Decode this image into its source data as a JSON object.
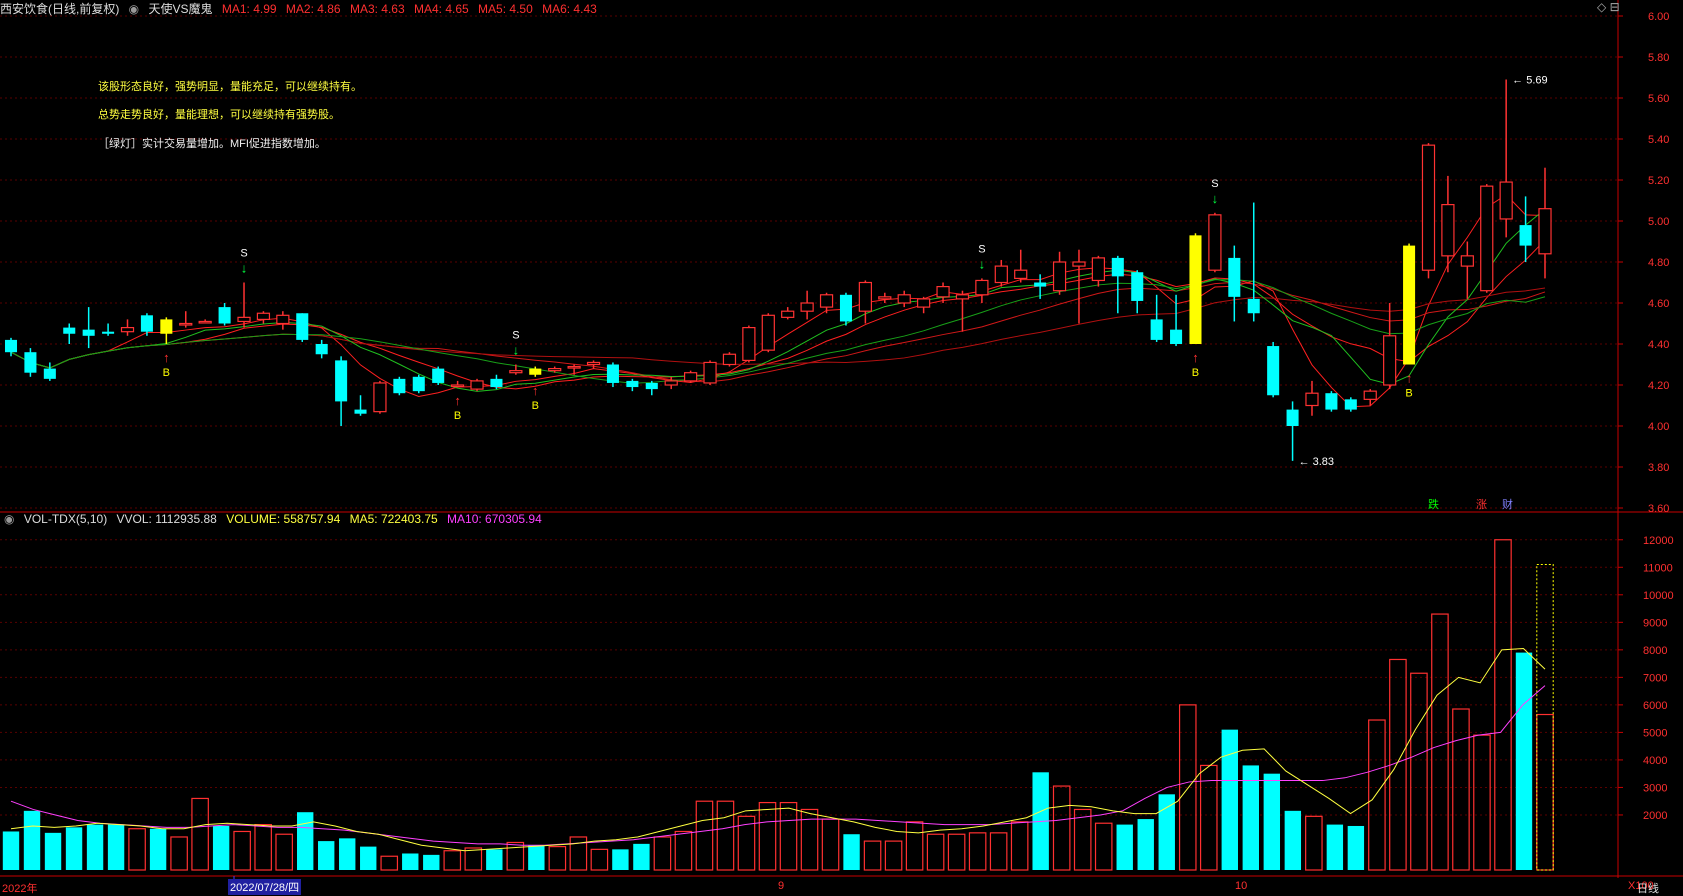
{
  "header": {
    "stock_title": "西安饮食(日线,前复权)",
    "indicator": "天使VS魔鬼",
    "ma": [
      "MA1: 4.99",
      "MA2: 4.86",
      "MA3: 4.63",
      "MA4: 4.65",
      "MA5: 4.50",
      "MA6: 4.43"
    ]
  },
  "notes": [
    "该股形态良好，强势明显，量能充足，可以继续持有。",
    "总势走势良好，量能理想，可以继续持有强势股。",
    "［绿灯］实计交易量增加。MFI促进指数增加。"
  ],
  "price_axis": [
    "6.00",
    "5.80",
    "5.60",
    "5.40",
    "5.20",
    "5.00",
    "4.80",
    "4.60",
    "4.40",
    "4.20",
    "4.00",
    "3.80",
    "3.60"
  ],
  "price_high_label": "5.69",
  "price_low_label": "3.83",
  "right_tags": [
    "跌",
    "涨",
    "财"
  ],
  "volume_header": {
    "name": "VOL-TDX(5,10)",
    "vvol": "VVOL: 1112935.88",
    "volume": "VOLUME: 558757.94",
    "ma5": "MA5: 722403.75",
    "ma10": "MA10: 670305.94"
  },
  "volume_axis": [
    "12000",
    "11000",
    "10000",
    "9000",
    "8000",
    "7000",
    "6000",
    "5000",
    "4000",
    "3000",
    "2000"
  ],
  "volume_unit": "X100",
  "date_axis": {
    "year": "2022年",
    "cursor": "2022/07/28/四",
    "m9": "9",
    "m10": "10",
    "period": "日线"
  },
  "signals": {
    "buy": "B",
    "sell": "S"
  },
  "colors": {
    "up": "#ff3232",
    "down": "#00ffff",
    "yellow": "#ffff00",
    "grid": "#5a0000",
    "axis": "#c80000"
  },
  "chart_data": {
    "type": "candlestick",
    "candles": [
      [
        4.42,
        4.36,
        4.43,
        4.34
      ],
      [
        4.36,
        4.26,
        4.38,
        4.24
      ],
      [
        4.28,
        4.23,
        4.31,
        4.22
      ],
      [
        4.48,
        4.45,
        4.5,
        4.4
      ],
      [
        4.47,
        4.44,
        4.58,
        4.38
      ],
      [
        4.46,
        4.45,
        4.5,
        4.44
      ],
      [
        4.46,
        4.48,
        4.52,
        4.44
      ],
      [
        4.54,
        4.46,
        4.55,
        4.44
      ],
      [
        4.52,
        4.45,
        4.53,
        4.4
      ],
      [
        4.5,
        4.5,
        4.56,
        4.48
      ],
      [
        4.51,
        4.51,
        4.52,
        4.5
      ],
      [
        4.58,
        4.5,
        4.6,
        4.49
      ],
      [
        4.51,
        4.53,
        4.7,
        4.48
      ],
      [
        4.52,
        4.55,
        4.56,
        4.5
      ],
      [
        4.5,
        4.54,
        4.56,
        4.47
      ],
      [
        4.55,
        4.42,
        4.55,
        4.41
      ],
      [
        4.4,
        4.35,
        4.42,
        4.33
      ],
      [
        4.32,
        4.12,
        4.34,
        4.0
      ],
      [
        4.08,
        4.06,
        4.15,
        4.05
      ],
      [
        4.07,
        4.21,
        4.22,
        4.06
      ],
      [
        4.23,
        4.16,
        4.24,
        4.15
      ],
      [
        4.24,
        4.17,
        4.25,
        4.16
      ],
      [
        4.28,
        4.21,
        4.29,
        4.2
      ],
      [
        4.2,
        4.2,
        4.22,
        4.19
      ],
      [
        4.18,
        4.22,
        4.23,
        4.17
      ],
      [
        4.23,
        4.19,
        4.25,
        4.18
      ],
      [
        4.26,
        4.27,
        4.3,
        4.25
      ],
      [
        4.28,
        4.25,
        4.29,
        4.24
      ],
      [
        4.27,
        4.28,
        4.29,
        4.26
      ],
      [
        4.29,
        4.29,
        4.3,
        4.25
      ],
      [
        4.3,
        4.31,
        4.32,
        4.28
      ],
      [
        4.3,
        4.21,
        4.31,
        4.19
      ],
      [
        4.22,
        4.19,
        4.23,
        4.17
      ],
      [
        4.21,
        4.18,
        4.22,
        4.15
      ],
      [
        4.2,
        4.22,
        4.24,
        4.18
      ],
      [
        4.22,
        4.26,
        4.27,
        4.21
      ],
      [
        4.21,
        4.31,
        4.32,
        4.2
      ],
      [
        4.3,
        4.35,
        4.36,
        4.29
      ],
      [
        4.32,
        4.48,
        4.49,
        4.31
      ],
      [
        4.37,
        4.54,
        4.55,
        4.36
      ],
      [
        4.53,
        4.56,
        4.58,
        4.52
      ],
      [
        4.56,
        4.6,
        4.66,
        4.52
      ],
      [
        4.58,
        4.64,
        4.65,
        4.55
      ],
      [
        4.64,
        4.51,
        4.65,
        4.49
      ],
      [
        4.56,
        4.7,
        4.71,
        4.5
      ],
      [
        4.62,
        4.63,
        4.65,
        4.6
      ],
      [
        4.6,
        4.64,
        4.66,
        4.58
      ],
      [
        4.58,
        4.62,
        4.63,
        4.55
      ],
      [
        4.63,
        4.68,
        4.7,
        4.6
      ],
      [
        4.62,
        4.64,
        4.66,
        4.46
      ],
      [
        4.64,
        4.71,
        4.72,
        4.6
      ],
      [
        4.7,
        4.78,
        4.81,
        4.68
      ],
      [
        4.72,
        4.76,
        4.86,
        4.7
      ],
      [
        4.7,
        4.68,
        4.74,
        4.62
      ],
      [
        4.66,
        4.8,
        4.85,
        4.64
      ],
      [
        4.78,
        4.8,
        4.86,
        4.5
      ],
      [
        4.71,
        4.82,
        4.83,
        4.68
      ],
      [
        4.82,
        4.73,
        4.83,
        4.55
      ],
      [
        4.75,
        4.61,
        4.76,
        4.55
      ],
      [
        4.52,
        4.42,
        4.64,
        4.41
      ],
      [
        4.47,
        4.4,
        4.64,
        4.39
      ],
      [
        4.4,
        4.93,
        4.94,
        4.4
      ],
      [
        4.76,
        5.03,
        5.04,
        4.75
      ],
      [
        4.82,
        4.63,
        4.88,
        4.51
      ],
      [
        4.62,
        4.55,
        5.09,
        4.51
      ],
      [
        4.39,
        4.15,
        4.41,
        4.14
      ],
      [
        4.08,
        4.0,
        4.12,
        3.83
      ],
      [
        4.1,
        4.16,
        4.22,
        4.05
      ],
      [
        4.16,
        4.08,
        4.17,
        4.07
      ],
      [
        4.13,
        4.08,
        4.14,
        4.07
      ],
      [
        4.13,
        4.17,
        4.18,
        4.1
      ],
      [
        4.2,
        4.44,
        4.6,
        4.18
      ],
      [
        4.3,
        4.88,
        4.89,
        4.3
      ],
      [
        4.76,
        5.37,
        5.38,
        4.72
      ],
      [
        4.83,
        5.08,
        5.22,
        4.75
      ],
      [
        4.78,
        4.83,
        4.9,
        4.62
      ],
      [
        4.66,
        5.17,
        5.18,
        4.65
      ],
      [
        5.01,
        5.19,
        5.69,
        4.92
      ],
      [
        4.98,
        4.88,
        5.12,
        4.8
      ],
      [
        4.84,
        5.06,
        5.26,
        4.72
      ]
    ],
    "candle_style": "up/down by open-close; yellow marked days",
    "yellow_days": [
      8,
      27,
      61,
      72
    ],
    "buy_days": [
      8,
      23,
      27,
      61,
      72
    ],
    "sell_days": [
      12,
      26,
      50,
      62
    ],
    "volumes": [
      1400,
      2150,
      1350,
      1550,
      1650,
      1650,
      1500,
      1500,
      1200,
      2600,
      1600,
      1400,
      1650,
      1300,
      2100,
      1050,
      1150,
      850,
      500,
      600,
      550,
      700,
      800,
      750,
      1000,
      900,
      850,
      1200,
      750,
      750,
      950,
      1200,
      1400,
      2500,
      2500,
      1950,
      2450,
      2450,
      2200,
      1850,
      1300,
      1050,
      1050,
      1750,
      1300,
      1300,
      1350,
      1350,
      1750,
      3550,
      3050,
      2200,
      1700,
      1650,
      1850,
      2750,
      6000,
      3800,
      5100,
      3800,
      3500,
      2150,
      1950,
      1650,
      1600,
      5450,
      7650,
      7150,
      9300,
      5850,
      4900,
      12000,
      7900,
      5650
    ],
    "ma5": [
      1500,
      1600,
      1550,
      1600,
      1700,
      1650,
      1600,
      1500,
      1500,
      1650,
      1700,
      1650,
      1600,
      1600,
      1750,
      1600,
      1400,
      1300,
      1100,
      900,
      800,
      700,
      750,
      800,
      850,
      900,
      950,
      1050,
      1100,
      1200,
      1400,
      1600,
      1800,
      1900,
      2150,
      2200,
      2250,
      2050,
      1900,
      1750,
      1550,
      1400,
      1350,
      1450,
      1500,
      1600,
      1750,
      1900,
      2250,
      2350,
      2300,
      2150,
      2050,
      2050,
      2500,
      3500,
      4100,
      4350,
      4400,
      3600,
      3100,
      2600,
      2050,
      2550,
      3650,
      5100,
      6350,
      7000,
      6800,
      8000,
      8050,
      7300
    ],
    "ma10": [
      2500,
      2200,
      2000,
      1800,
      1700,
      1650,
      1600,
      1550,
      1550,
      1600,
      1650,
      1600,
      1550,
      1550,
      1500,
      1450,
      1350,
      1250,
      1150,
      1050,
      1000,
      950,
      950,
      900,
      900,
      950,
      1000,
      1050,
      1100,
      1200,
      1300,
      1400,
      1500,
      1650,
      1750,
      1800,
      1850,
      1850,
      1850,
      1800,
      1750,
      1700,
      1650,
      1650,
      1650,
      1700,
      1750,
      1800,
      1900,
      2000,
      2150,
      2600,
      3000,
      3200,
      3250,
      3250,
      3250,
      3250,
      3250,
      3250,
      3350,
      3550,
      3800,
      4100,
      4450,
      4700,
      4900,
      5000,
      6000,
      6700
    ],
    "ylim_price": [
      3.6,
      6.0
    ],
    "ylim_volume": [
      0,
      12500
    ]
  }
}
